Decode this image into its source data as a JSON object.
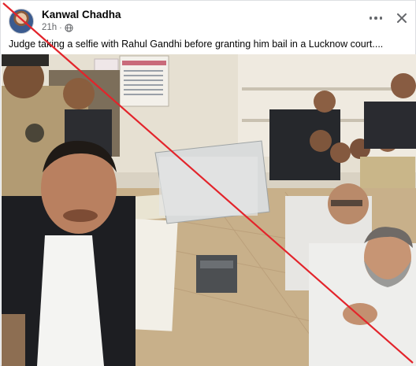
{
  "post": {
    "author": "Kanwal Chadha",
    "time": "21h",
    "separator": "·",
    "privacy_icon": "globe-icon",
    "caption": "Judge taking a selfie with Rahul Gandhi before granting him bail in a Lucknow court....",
    "menu_icon": "more-horizontal-icon",
    "close_icon": "close-icon"
  },
  "photo": {
    "description_icon": "photo",
    "overlay_mark": "red-diagonal-strike"
  },
  "colors": {
    "strike": "#e3242b",
    "text": "#050505",
    "meta": "#65676b",
    "border": "#dddfe2"
  }
}
